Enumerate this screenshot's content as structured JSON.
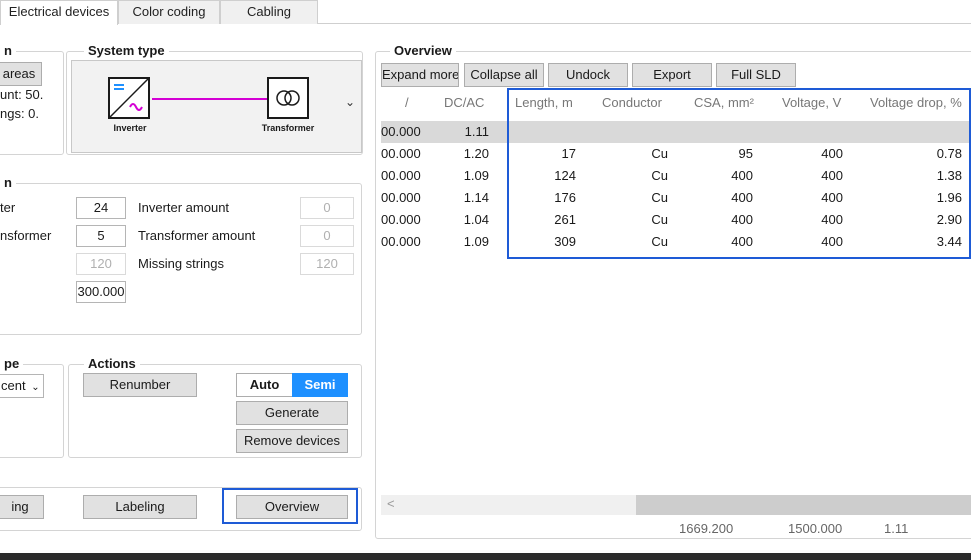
{
  "tabs": [
    "Electrical devices",
    "Color coding",
    "Cabling"
  ],
  "left": {
    "areas_btn": "areas",
    "amount_text": "unt: 50.",
    "strings_text": "ngs: 0.",
    "system_type": {
      "title": "System type",
      "inverter": "Inverter",
      "transformer": "Transformer",
      "dropdown": "⌄"
    },
    "grid": {
      "row1_label": "ter",
      "row1_val": "24",
      "row1_amount_label": "Inverter amount",
      "row1_amount_val": "0",
      "row2_label": "nsformer",
      "row2_val": "5",
      "row2_amount_label": "Transformer amount",
      "row2_amount_val": "0",
      "row3_val": "120",
      "row3_label": "Missing strings",
      "row3_missing_val": "120",
      "row4_val": "300.000"
    },
    "type_title": "pe",
    "type_select": "cent",
    "actions": {
      "title": "Actions",
      "renumber": "Renumber",
      "auto": "Auto",
      "semi": "Semi",
      "generate": "Generate",
      "remove": "Remove devices"
    },
    "bottom": {
      "ing": "ing",
      "labeling": "Labeling",
      "overview": "Overview"
    }
  },
  "overview": {
    "title": "Overview",
    "toolbar": [
      "Expand more",
      "Collapse all",
      "Undock",
      "Export",
      "Full SLD"
    ],
    "columns": [
      "/",
      "DC/AC",
      "Length, m",
      "Conductor",
      "CSA, mm²",
      "Voltage, V",
      "Voltage drop, %"
    ],
    "rows": [
      [
        "00.000",
        "1.11",
        "",
        "",
        "",
        "",
        ""
      ],
      [
        "00.000",
        "1.20",
        "17",
        "Cu",
        "95",
        "400",
        "0.78"
      ],
      [
        "00.000",
        "1.09",
        "124",
        "Cu",
        "400",
        "400",
        "1.38"
      ],
      [
        "00.000",
        "1.14",
        "176",
        "Cu",
        "400",
        "400",
        "1.96"
      ],
      [
        "00.000",
        "1.04",
        "261",
        "Cu",
        "400",
        "400",
        "2.90"
      ],
      [
        "00.000",
        "1.09",
        "309",
        "Cu",
        "400",
        "400",
        "3.44"
      ]
    ],
    "scroll_left": "<",
    "footer": [
      "1669.200",
      "1500.000",
      "1.11"
    ]
  },
  "colors": {
    "accent": "#1e90ff",
    "highlight": "#1e5bd6",
    "wire": "#d400d4"
  }
}
